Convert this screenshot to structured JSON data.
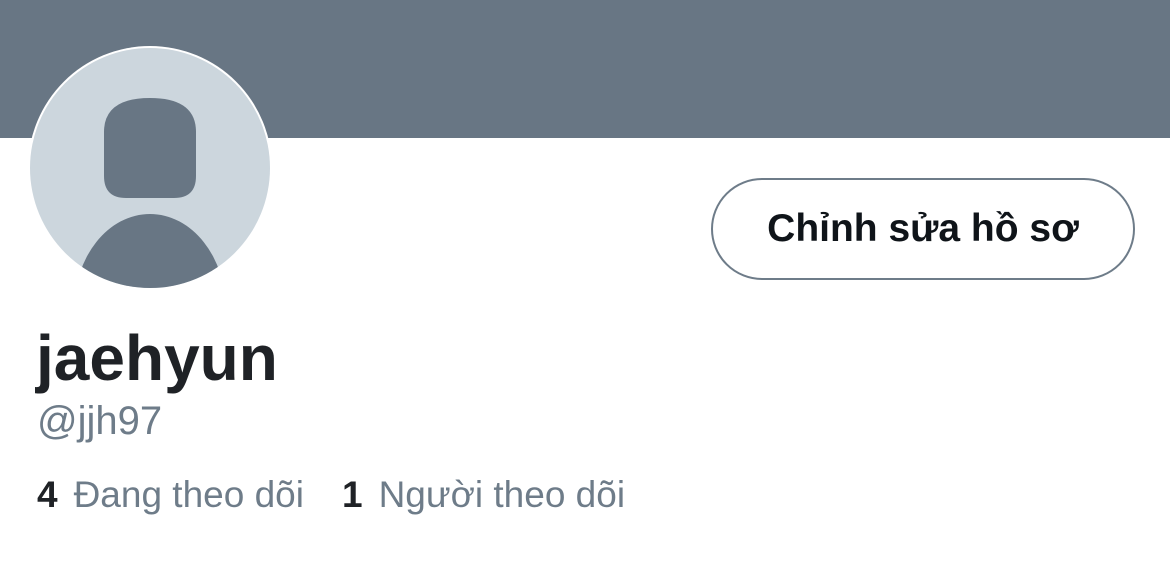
{
  "profile": {
    "display_name": "jaehyun",
    "handle": "@jjh97",
    "avatar_icon": "default-user-avatar-icon",
    "edit_button_label": "Chỉnh sửa hồ sơ"
  },
  "stats": {
    "following_count": "4",
    "following_label": "Đang theo dõi",
    "followers_count": "1",
    "followers_label": "Người theo dõi"
  },
  "colors": {
    "banner": "#687684",
    "avatar_bg": "#ccd6dd",
    "avatar_figure": "#687684",
    "secondary_text": "#6e7c89",
    "primary_text": "#1f2226",
    "button_border": "#6e7c89"
  }
}
